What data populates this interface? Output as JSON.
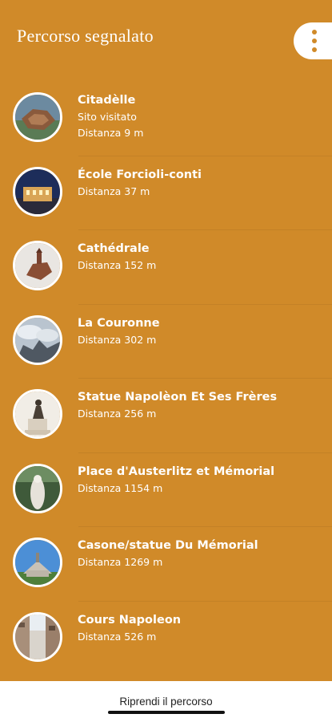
{
  "header": {
    "title": "Percorso segnalato",
    "menu_icon": "more-vertical-icon"
  },
  "route": {
    "items": [
      {
        "name": "Citadèlle",
        "status": "Sito visitato",
        "distance": "Distanza 9 m"
      },
      {
        "name": "École Forcioli-conti",
        "distance": "Distanza 37 m"
      },
      {
        "name": "Cathédrale",
        "distance": "Distanza 152 m"
      },
      {
        "name": "La Couronne",
        "distance": "Distanza 302 m"
      },
      {
        "name": "Statue Napolèon Et Ses Frères",
        "distance": "Distanza 256 m"
      },
      {
        "name": "Place d'Austerlitz et Mémorial",
        "distance": "Distanza 1154 m"
      },
      {
        "name": "Casone/statue Du Mémorial",
        "distance": "Distanza 1269 m"
      },
      {
        "name": "Cours Napoleon",
        "distance": "Distanza 526 m"
      }
    ]
  },
  "footer": {
    "resume_label": "Riprendi il percorso"
  },
  "colors": {
    "background": "#d08a29",
    "text": "#ffffff",
    "footer_bg": "#ffffff"
  }
}
